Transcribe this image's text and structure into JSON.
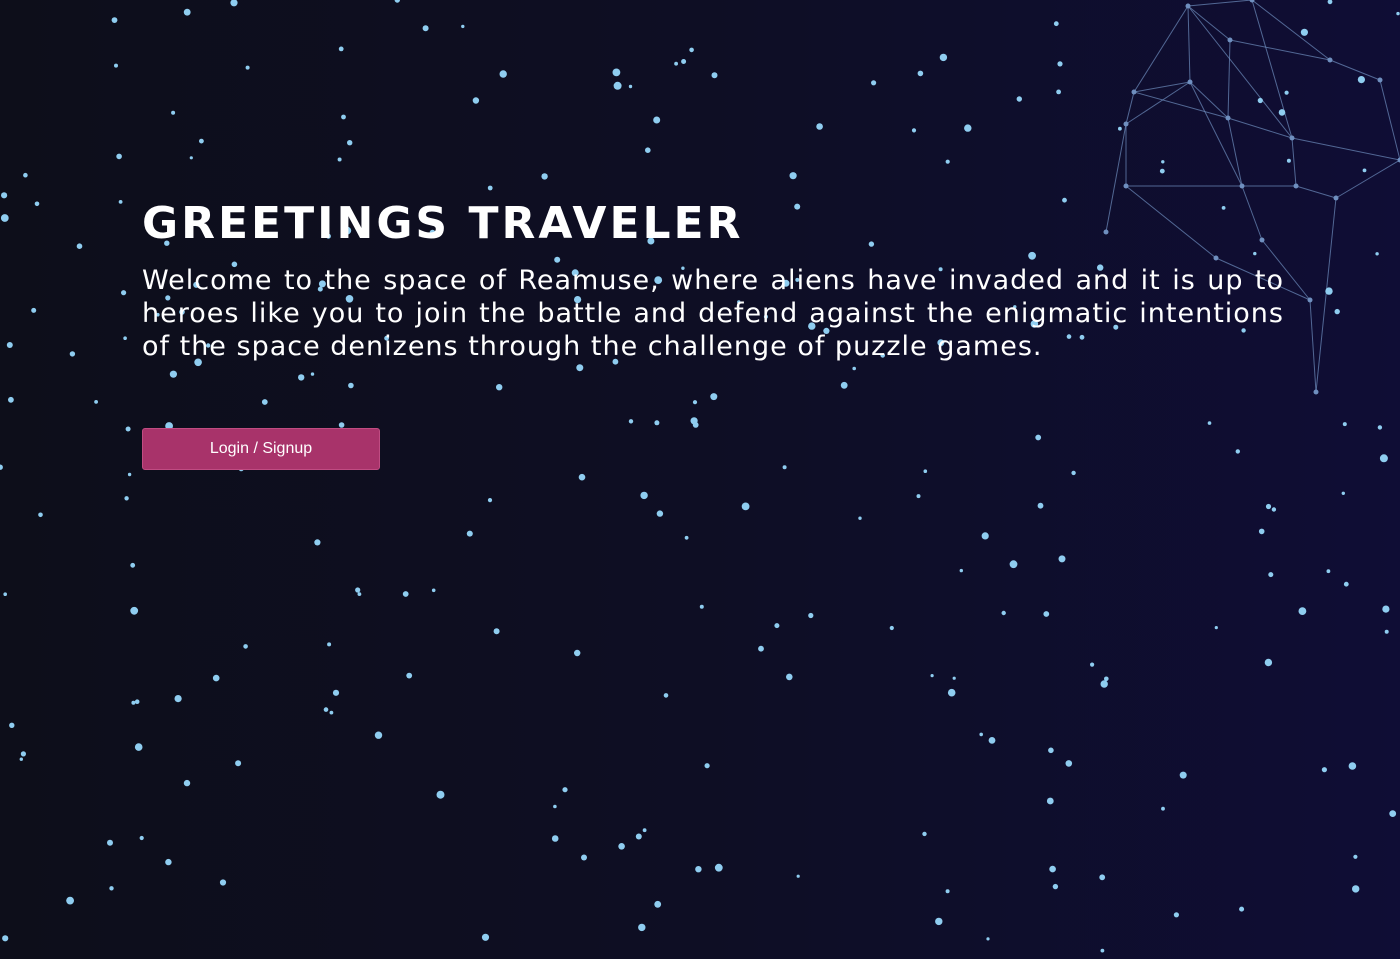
{
  "hero": {
    "title": "GREETINGS TRAVELER",
    "description": "Welcome to the space of Reamuse, where aliens have invaded and it is up to heroes like you to join the battle and defend against the enigmatic intentions of the space denizens through the challenge of puzzle games.",
    "cta_label": "Login / Signup"
  },
  "colors": {
    "star": "#8fcdf0",
    "network_line": "#6f8fbf",
    "button": "#a8336a",
    "text": "#ffffff"
  }
}
